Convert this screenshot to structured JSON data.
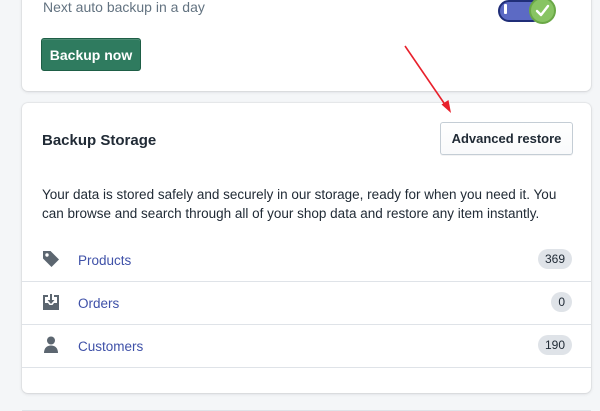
{
  "backup_card": {
    "next_backup_text": "Next auto backup in a day",
    "backup_now_label": "Backup now",
    "auto_backup_enabled": true
  },
  "storage_card": {
    "title": "Backup Storage",
    "advanced_restore_label": "Advanced restore",
    "description": "Your data is stored safely and securely in our storage, ready for when you need it. You can browse and search through all of your shop data and restore any item instantly.",
    "resources": [
      {
        "label": "Products",
        "count": "369",
        "icon": "tag-icon"
      },
      {
        "label": "Orders",
        "count": "0",
        "icon": "download-tray-icon"
      },
      {
        "label": "Customers",
        "count": "190",
        "icon": "person-icon"
      }
    ]
  },
  "colors": {
    "primary_button": "#2f7b5f",
    "link": "#3f51a8",
    "toggle_track": "#5c6ac4",
    "toggle_knob": "#88c463",
    "annotation_arrow": "#e8212c",
    "page_background": "#f4f6f8"
  }
}
